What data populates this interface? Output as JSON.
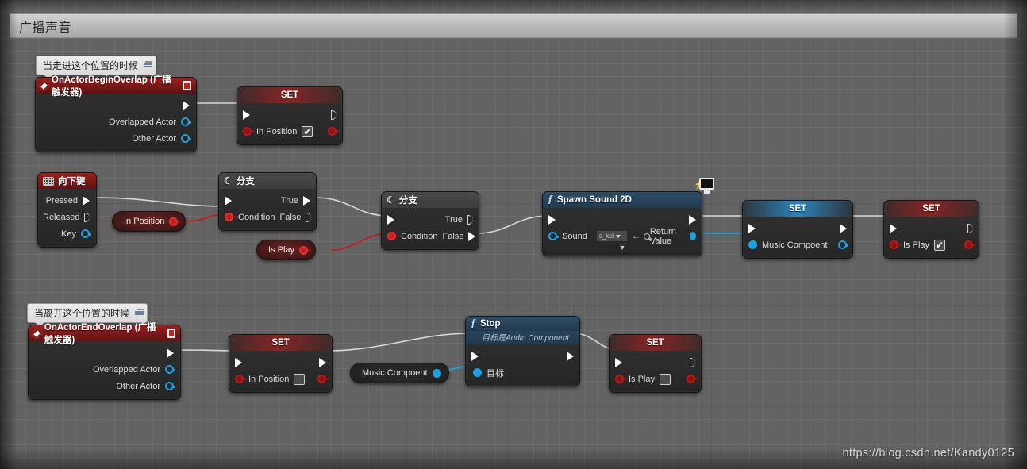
{
  "window": {
    "title": "广播声音"
  },
  "watermark": "https://blog.csdn.net/Kandy0125",
  "comments": [
    {
      "text": "当走进这个位置的时候"
    },
    {
      "text": "当离开这个位置的时候"
    }
  ],
  "nodes": {
    "begin_overlap": {
      "title": "OnActorBeginOverlap (广播触发器)",
      "icon": "event-diamond-icon",
      "out_exec": "",
      "pins": [
        "Overlapped Actor",
        "Other Actor"
      ]
    },
    "set_in_position_true": {
      "title": "SET",
      "pin_label": "In Position",
      "value": "checked",
      "check_glyph": "✔"
    },
    "key_down": {
      "title": "向下键",
      "icon": "keyboard-icon",
      "pins": [
        "Pressed",
        "Released",
        "Key"
      ]
    },
    "branch_1": {
      "title": "分支",
      "icon": "branch-icon",
      "in_pins": [
        "Condition"
      ],
      "out_pins": [
        "True",
        "False"
      ]
    },
    "branch_2": {
      "title": "分支",
      "icon": "branch-icon",
      "in_pins": [
        "Condition"
      ],
      "out_pins": [
        "True",
        "False"
      ]
    },
    "get_in_position": {
      "label": "In Position"
    },
    "get_is_play": {
      "label": "Is Play"
    },
    "spawn_sound_2d": {
      "title": "Spawn Sound 2D",
      "icon": "function-icon",
      "badge_icon": "client-monitor-icon",
      "in_pin": "Sound",
      "dropdown_value": "s_kci",
      "out_pin": "Return Value",
      "expander_glyph": "▼"
    },
    "set_music_component": {
      "title": "SET",
      "pin_label": "Music Compoent"
    },
    "set_is_play_true": {
      "title": "SET",
      "pin_label": "Is Play",
      "value": "checked",
      "check_glyph": "✔"
    },
    "end_overlap": {
      "title": "OnActorEndOverlap (广播触发器)",
      "icon": "event-diamond-icon",
      "pins": [
        "Overlapped Actor",
        "Other Actor"
      ]
    },
    "set_in_position_false": {
      "title": "SET",
      "pin_label": "In Position",
      "value": "unchecked",
      "check_glyph": ""
    },
    "get_music_component": {
      "label": "Music Compoent"
    },
    "stop": {
      "title": "Stop",
      "subtitle": "目标是Audio Component",
      "icon": "function-icon",
      "target_pin": "目标"
    },
    "set_is_play_false": {
      "title": "SET",
      "pin_label": "Is Play",
      "value": "unchecked",
      "check_glyph": ""
    }
  },
  "colors": {
    "exec_wire": "#d8d8d8",
    "bool_wire": "#c02020",
    "object_wire": "#1ea0e0",
    "event_header": "#7a1818",
    "function_header": "#27425a",
    "canvas": "#636363"
  }
}
